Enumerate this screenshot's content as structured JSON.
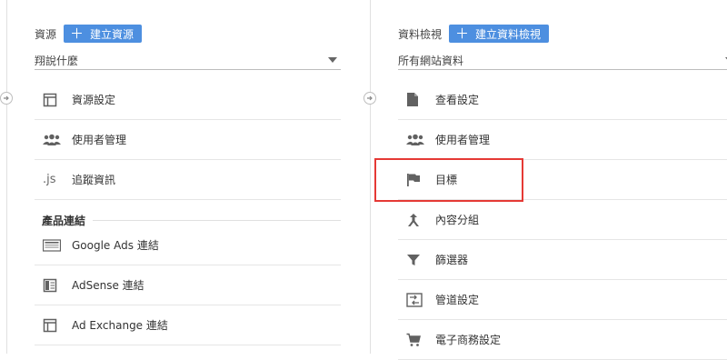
{
  "left": {
    "header_label": "資源",
    "add_button_label": "建立資源",
    "dropdown_value": "翔說什麼",
    "items": [
      {
        "label": "資源設定",
        "icon": "property-settings-icon"
      },
      {
        "label": "使用者管理",
        "icon": "users-icon"
      },
      {
        "label": "追蹤資訊",
        "icon": "js-icon",
        "icon_text": ".js"
      }
    ],
    "section_title": "產品連結",
    "product_items": [
      {
        "label": "Google Ads 連結",
        "icon": "google-ads-link-icon"
      },
      {
        "label": "AdSense 連結",
        "icon": "adsense-link-icon"
      },
      {
        "label": "Ad Exchange 連結",
        "icon": "ad-exchange-link-icon"
      }
    ]
  },
  "right": {
    "header_label": "資料檢視",
    "add_button_label": "建立資料檢視",
    "dropdown_value": "所有網站資料",
    "items": [
      {
        "label": "查看設定",
        "icon": "view-settings-icon"
      },
      {
        "label": "使用者管理",
        "icon": "users-icon"
      },
      {
        "label": "目標",
        "icon": "flag-icon"
      },
      {
        "label": "內容分組",
        "icon": "content-grouping-icon"
      },
      {
        "label": "篩選器",
        "icon": "filter-icon"
      },
      {
        "label": "管道設定",
        "icon": "channel-settings-icon"
      },
      {
        "label": "電子商務設定",
        "icon": "shopping-cart-icon"
      }
    ]
  },
  "colors": {
    "accent": "#4d8fe0",
    "highlight": "#e53935",
    "icon": "#616161"
  }
}
